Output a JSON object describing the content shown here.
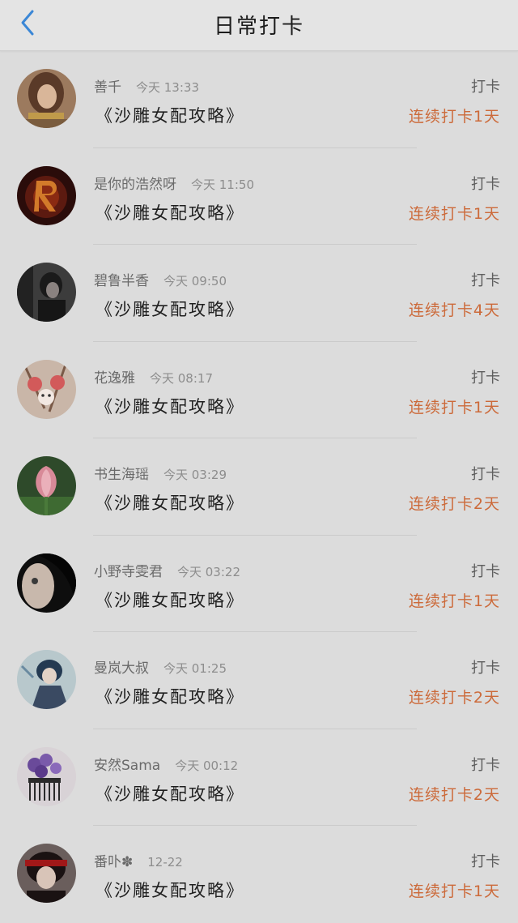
{
  "header": {
    "title": "日常打卡"
  },
  "items": [
    {
      "name": "善千",
      "time": "今天 13:33",
      "book": "《沙雕女配攻略》",
      "tag": "打卡",
      "streak": "连续打卡1天"
    },
    {
      "name": "是你的浩然呀",
      "time": "今天 11:50",
      "book": "《沙雕女配攻略》",
      "tag": "打卡",
      "streak": "连续打卡1天"
    },
    {
      "name": "碧鲁半香",
      "time": "今天 09:50",
      "book": "《沙雕女配攻略》",
      "tag": "打卡",
      "streak": "连续打卡4天"
    },
    {
      "name": "花逸雅",
      "time": "今天 08:17",
      "book": "《沙雕女配攻略》",
      "tag": "打卡",
      "streak": "连续打卡1天"
    },
    {
      "name": "书生海瑶",
      "time": "今天 03:29",
      "book": "《沙雕女配攻略》",
      "tag": "打卡",
      "streak": "连续打卡2天"
    },
    {
      "name": "小野寺雯君",
      "time": "今天 03:22",
      "book": "《沙雕女配攻略》",
      "tag": "打卡",
      "streak": "连续打卡1天"
    },
    {
      "name": "曼岚大叔",
      "time": "今天 01:25",
      "book": "《沙雕女配攻略》",
      "tag": "打卡",
      "streak": "连续打卡2天"
    },
    {
      "name": "安然Sama",
      "time": "今天 00:12",
      "book": "《沙雕女配攻略》",
      "tag": "打卡",
      "streak": "连续打卡2天"
    },
    {
      "name": "番卟✽",
      "time": "12-22",
      "book": "《沙雕女配攻略》",
      "tag": "打卡",
      "streak": "连续打卡1天"
    }
  ]
}
